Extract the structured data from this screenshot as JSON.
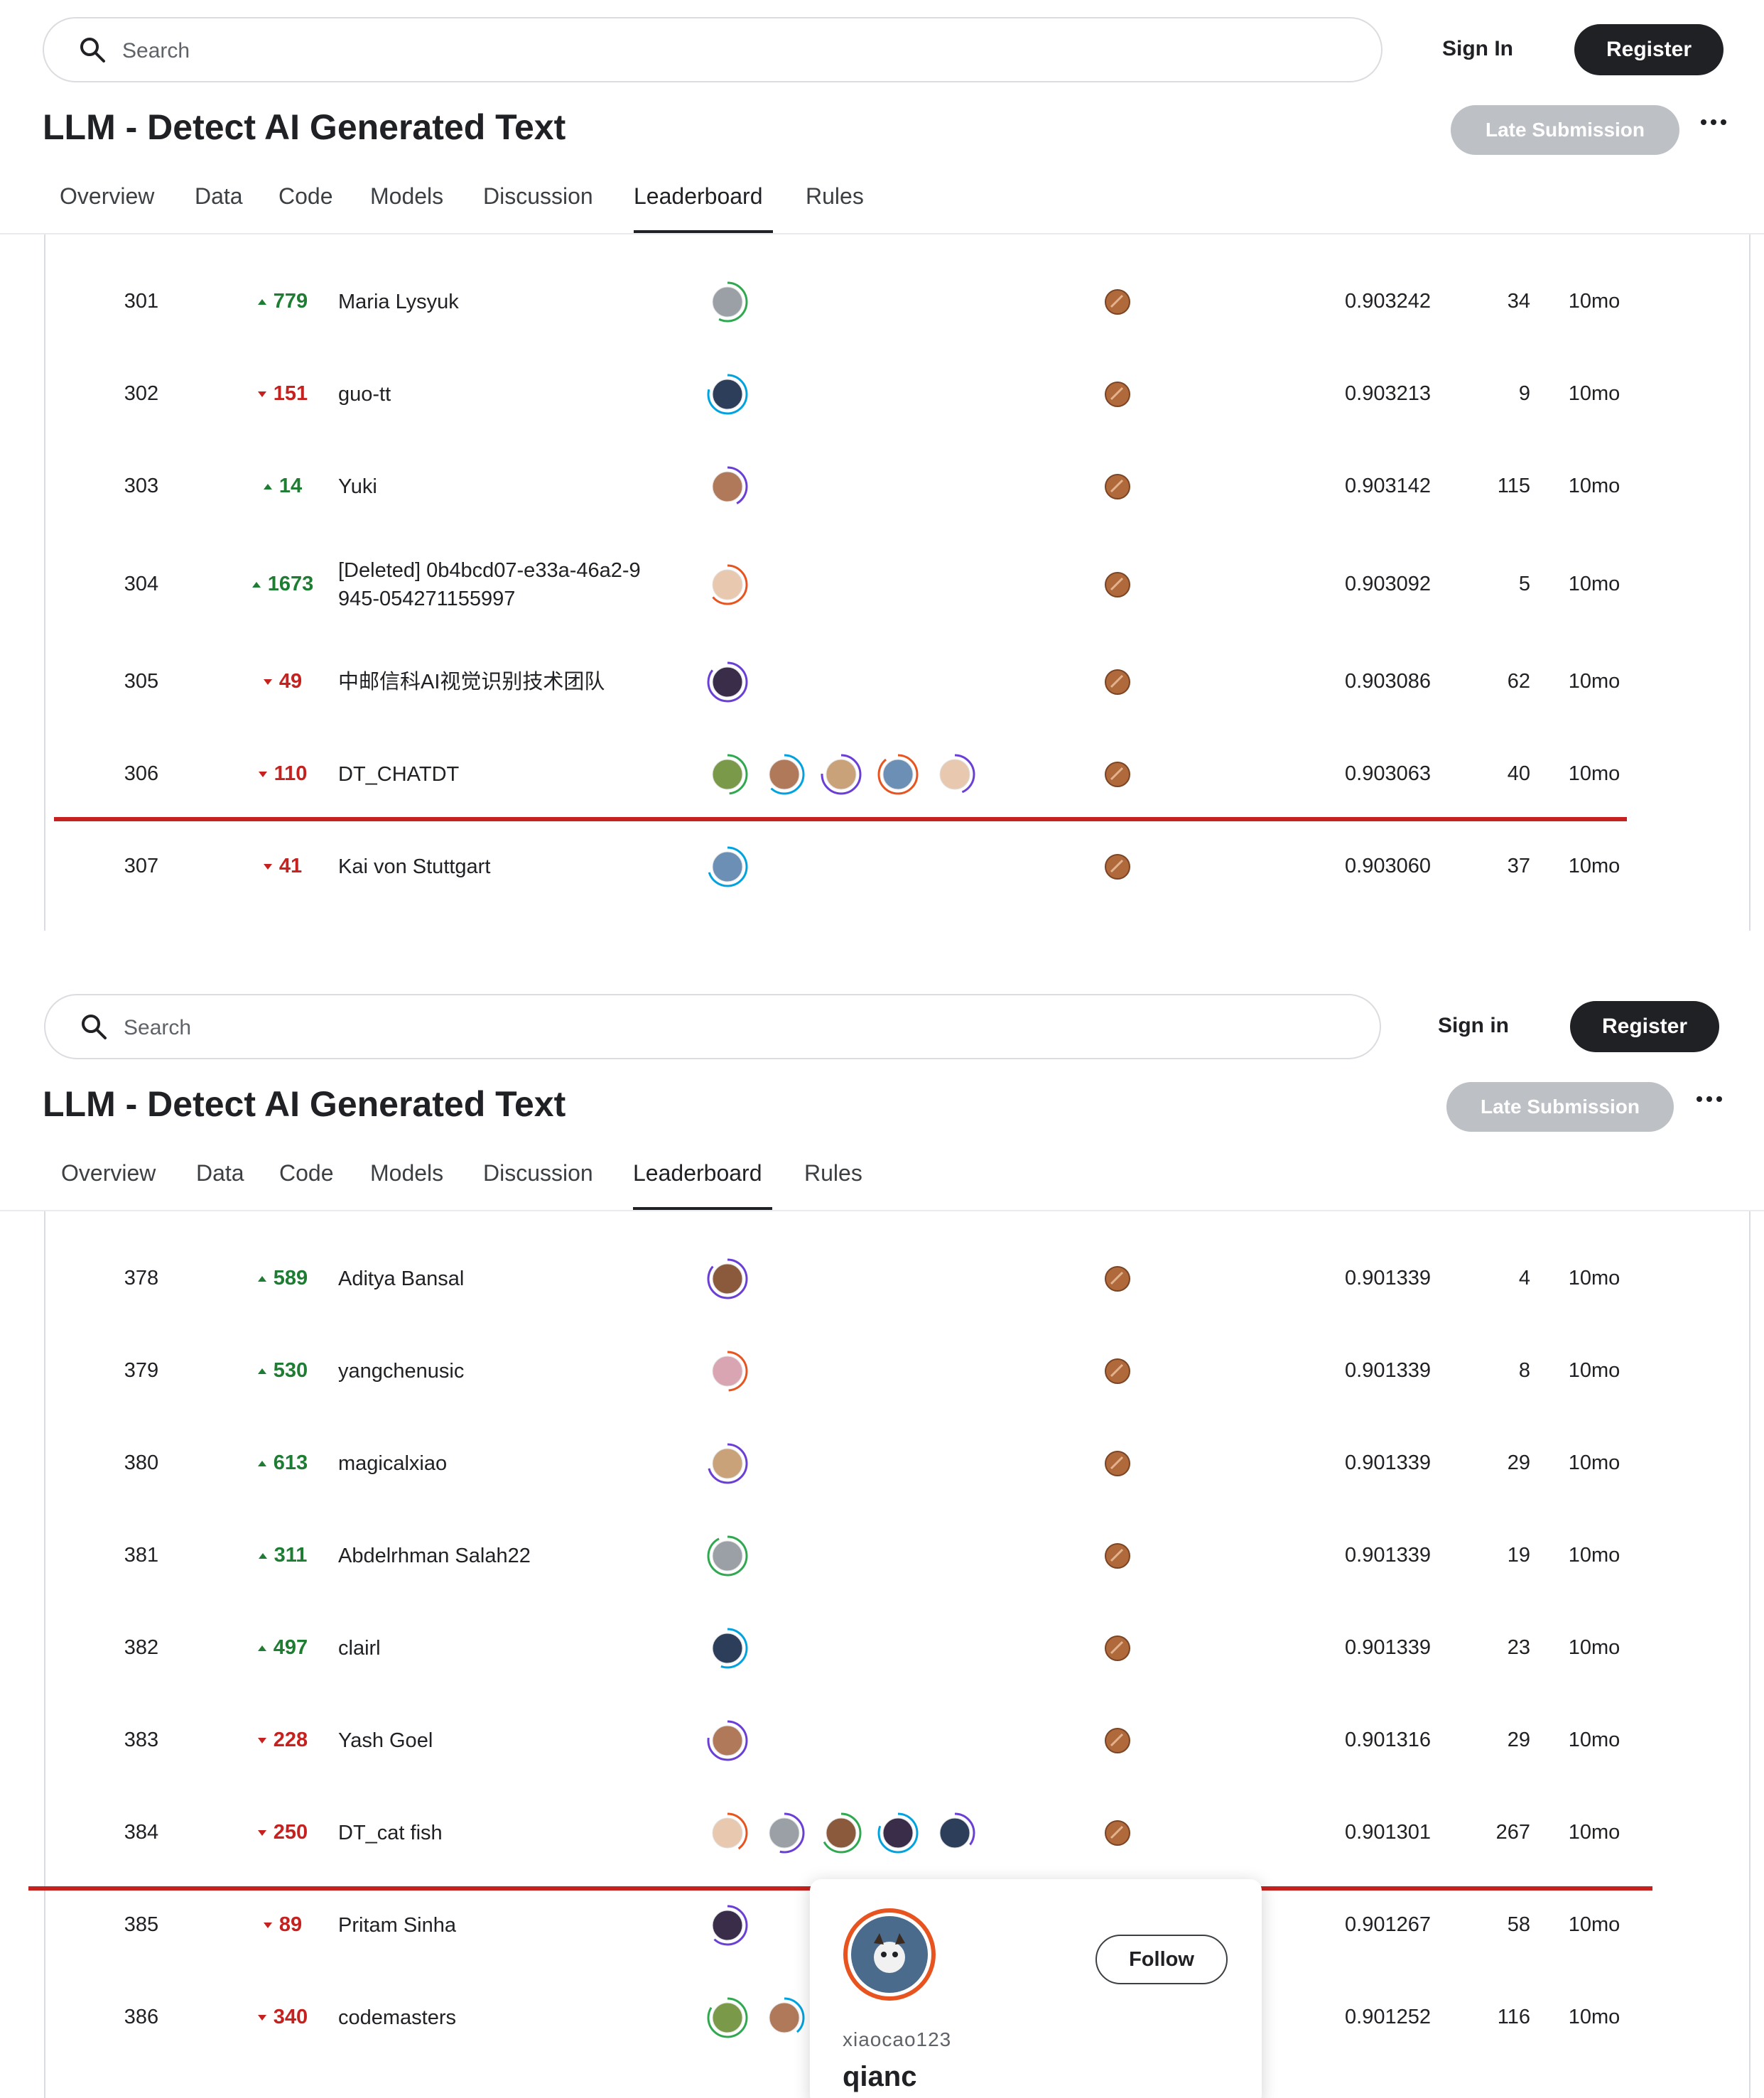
{
  "header": {
    "search_placeholder": "Search",
    "sign_in": "Sign In",
    "sign_in_alt": "Sign in",
    "register": "Register",
    "title": "LLM - Detect AI Generated Text",
    "late_submission": "Late Submission",
    "tabs": [
      "Overview",
      "Data",
      "Code",
      "Models",
      "Discussion",
      "Leaderboard",
      "Rules"
    ],
    "active_tab": "Leaderboard"
  },
  "leaderboard_top": {
    "rows": [
      {
        "rank": "301",
        "dir": "up",
        "delta": "779",
        "team": "Maria Lysyuk",
        "avatars": 1,
        "score": "0.903242",
        "entries": "34",
        "last": "10mo"
      },
      {
        "rank": "302",
        "dir": "down",
        "delta": "151",
        "team": "guo-tt",
        "avatars": 1,
        "score": "0.903213",
        "entries": "9",
        "last": "10mo"
      },
      {
        "rank": "303",
        "dir": "up",
        "delta": "14",
        "team": "Yuki",
        "avatars": 1,
        "score": "0.903142",
        "entries": "115",
        "last": "10mo"
      },
      {
        "rank": "304",
        "dir": "up",
        "delta": "1673",
        "team": "[Deleted] 0b4bcd07-e33a-46a2-9945-054271155997",
        "team_line1": "[Deleted] 0b4bcd07-e33a-46a2-9",
        "team_line2": "945-054271155997",
        "avatars": 1,
        "score": "0.903092",
        "entries": "5",
        "last": "10mo"
      },
      {
        "rank": "305",
        "dir": "down",
        "delta": "49",
        "team": "中邮信科AI视觉识别技术团队",
        "avatars": 1,
        "score": "0.903086",
        "entries": "62",
        "last": "10mo"
      },
      {
        "rank": "306",
        "dir": "down",
        "delta": "110",
        "team": "DT_CHATDT",
        "avatars": 5,
        "score": "0.903063",
        "entries": "40",
        "last": "10mo"
      },
      {
        "rank": "307",
        "dir": "down",
        "delta": "41",
        "team": "Kai von Stuttgart",
        "avatars": 1,
        "score": "0.903060",
        "entries": "37",
        "last": "10mo"
      }
    ]
  },
  "leaderboard_bottom": {
    "rows": [
      {
        "rank": "378",
        "dir": "up",
        "delta": "589",
        "team": "Aditya Bansal",
        "avatars": 1,
        "score": "0.901339",
        "entries": "4",
        "last": "10mo"
      },
      {
        "rank": "379",
        "dir": "up",
        "delta": "530",
        "team": "yangchenusic",
        "avatars": 1,
        "score": "0.901339",
        "entries": "8",
        "last": "10mo"
      },
      {
        "rank": "380",
        "dir": "up",
        "delta": "613",
        "team": "magicalxiao",
        "avatars": 1,
        "score": "0.901339",
        "entries": "29",
        "last": "10mo"
      },
      {
        "rank": "381",
        "dir": "up",
        "delta": "311",
        "team": "Abdelrhman Salah22",
        "avatars": 1,
        "score": "0.901339",
        "entries": "19",
        "last": "10mo"
      },
      {
        "rank": "382",
        "dir": "up",
        "delta": "497",
        "team": "clairl",
        "avatars": 1,
        "score": "0.901339",
        "entries": "23",
        "last": "10mo"
      },
      {
        "rank": "383",
        "dir": "down",
        "delta": "228",
        "team": "Yash Goel",
        "avatars": 1,
        "score": "0.901316",
        "entries": "29",
        "last": "10mo"
      },
      {
        "rank": "384",
        "dir": "down",
        "delta": "250",
        "team": "DT_cat fish",
        "avatars": 5,
        "score": "0.901301",
        "entries": "267",
        "last": "10mo"
      },
      {
        "rank": "385",
        "dir": "down",
        "delta": "89",
        "team": "Pritam Sinha",
        "avatars": 1,
        "score": "0.901267",
        "entries": "58",
        "last": "10mo"
      },
      {
        "rank": "386",
        "dir": "down",
        "delta": "340",
        "team": "codemasters",
        "avatars": 2,
        "score": "0.901252",
        "entries": "116",
        "last": "10mo"
      }
    ]
  },
  "profile_popup": {
    "follow": "Follow",
    "username": "xiaocao123",
    "display_name": "qianc"
  },
  "colors": {
    "up": "#1e7d32",
    "down": "#c5221f",
    "highlight_line": "#c5221f",
    "medal": "#b0693a"
  }
}
